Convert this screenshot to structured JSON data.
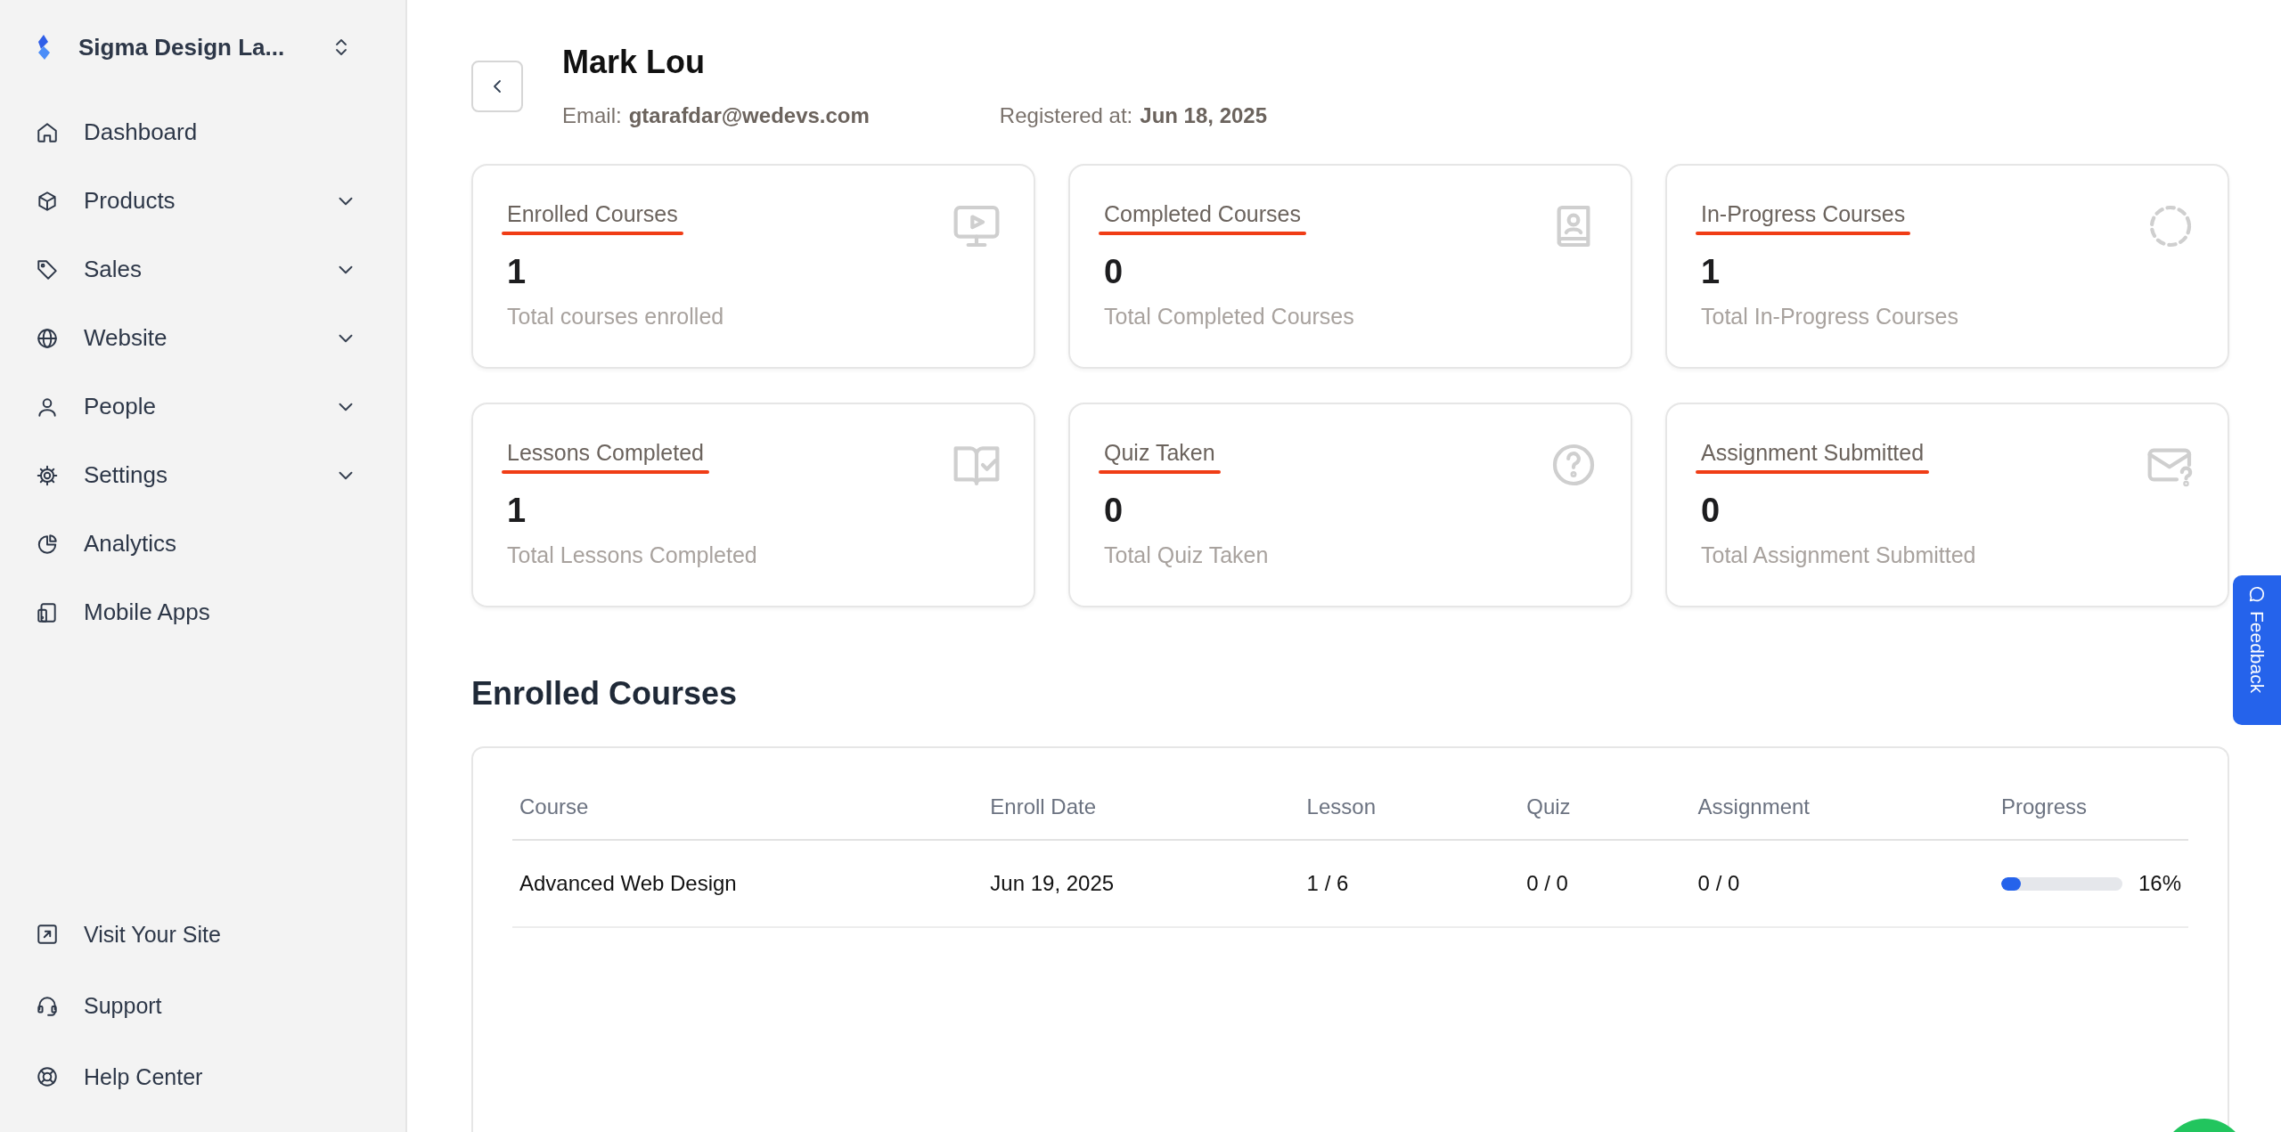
{
  "sidebar": {
    "brand": "Sigma Design La...",
    "items": [
      {
        "label": "Dashboard",
        "expandable": false
      },
      {
        "label": "Products",
        "expandable": true
      },
      {
        "label": "Sales",
        "expandable": true
      },
      {
        "label": "Website",
        "expandable": true
      },
      {
        "label": "People",
        "expandable": true
      },
      {
        "label": "Settings",
        "expandable": true
      },
      {
        "label": "Analytics",
        "expandable": false
      },
      {
        "label": "Mobile Apps",
        "expandable": false
      }
    ],
    "footer_items": [
      {
        "label": "Visit Your Site"
      },
      {
        "label": "Support"
      },
      {
        "label": "Help Center"
      }
    ]
  },
  "profile": {
    "name": "Mark Lou",
    "email_label": "Email:",
    "email": "gtarafdar@wedevs.com",
    "registered_label": "Registered at:",
    "registered": "Jun 18, 2025"
  },
  "stats": [
    {
      "title": "Enrolled Courses",
      "value": "1",
      "caption": "Total courses enrolled",
      "underlined": true
    },
    {
      "title": "Completed Courses",
      "value": "0",
      "caption": "Total Completed Courses",
      "underlined": true
    },
    {
      "title": "In-Progress Courses",
      "value": "1",
      "caption": "Total In-Progress Courses",
      "underlined": true
    },
    {
      "title": "Lessons Completed",
      "value": "1",
      "caption": "Total Lessons Completed",
      "underlined": true
    },
    {
      "title": "Quiz Taken",
      "value": "0",
      "caption": "Total Quiz Taken",
      "underlined": true
    },
    {
      "title": "Assignment Submitted",
      "value": "0",
      "caption": "Total Assignment Submitted",
      "underlined": true
    }
  ],
  "enrolled": {
    "title": "Enrolled Courses",
    "columns": [
      "Course",
      "Enroll Date",
      "Lesson",
      "Quiz",
      "Assignment",
      "Progress"
    ],
    "rows": [
      {
        "course": "Advanced Web Design",
        "enroll_date": "Jun 19, 2025",
        "lesson": "1 / 6",
        "quiz": "0 / 0",
        "assignment": "0 / 0",
        "level": 0.16,
        "progress": "16%"
      }
    ]
  },
  "feedback": {
    "label": "Feedback"
  }
}
